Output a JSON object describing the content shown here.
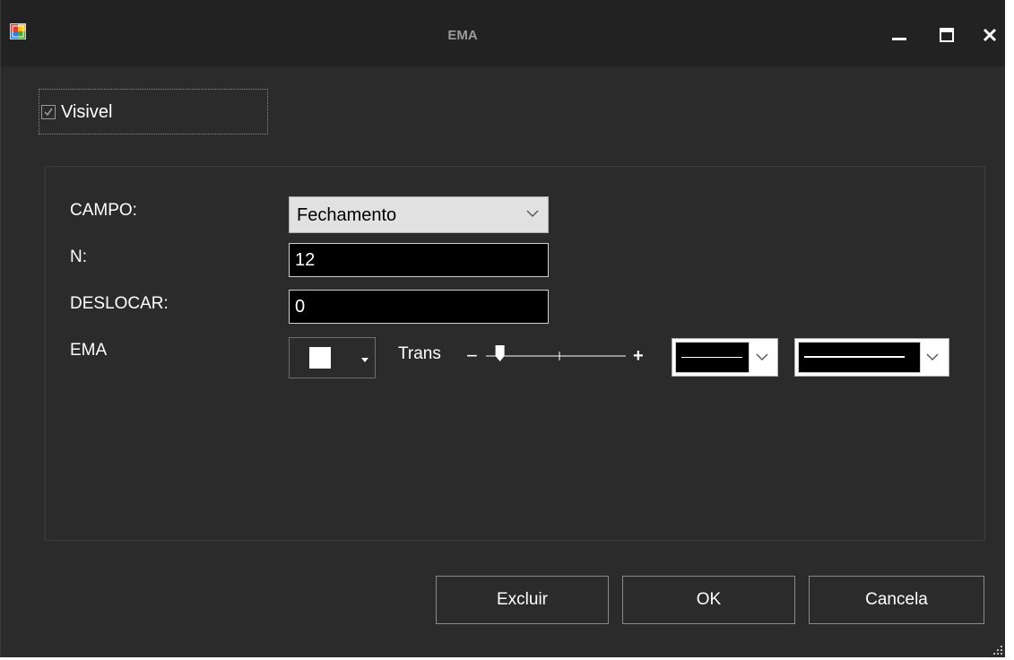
{
  "window": {
    "title": "EMA",
    "icon": "app-form-icon"
  },
  "titlebar_buttons": [
    "minimize-icon",
    "maximize-icon",
    "close-icon"
  ],
  "visible_checkbox": {
    "label": "Visivel",
    "checked": true
  },
  "form": {
    "campo": {
      "label": "CAMPO:",
      "value": "Fechamento"
    },
    "n": {
      "label": "N:",
      "value": "12"
    },
    "deslocar": {
      "label": "DESLOCAR:",
      "value": "0"
    },
    "ema": {
      "label": "EMA",
      "color": "#ffffff",
      "trans_label": "Trans",
      "trans_minus": "−",
      "trans_plus": "+",
      "trans_level": 0.1
    }
  },
  "buttons": {
    "excluir": "Excluir",
    "ok": "OK",
    "cancela": "Cancela"
  },
  "colors": {
    "background": "#2b2b2b",
    "titlebar": "#222222",
    "text": "#ffffff"
  }
}
